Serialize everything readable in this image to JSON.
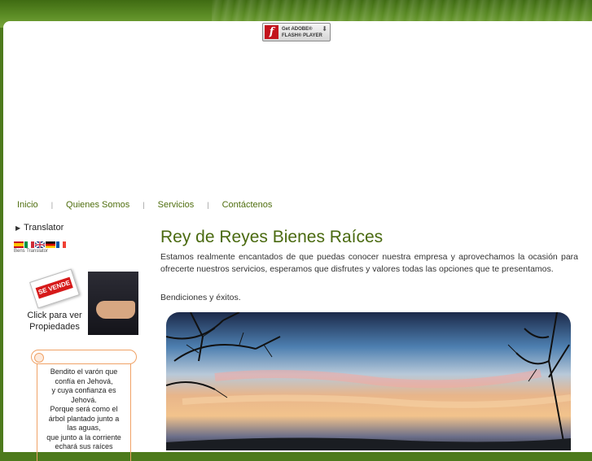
{
  "flash": {
    "text": "Get ADOBE®\nFLASH® PLAYER",
    "logo": "f"
  },
  "nav": {
    "items": [
      {
        "label": "Inicio"
      },
      {
        "label": "Quienes Somos"
      },
      {
        "label": "Servicios"
      },
      {
        "label": "Contáctenos"
      }
    ],
    "separator": "|"
  },
  "sidebar": {
    "translator_title": "Translator",
    "translator_caption": "Bens Translator",
    "flags": [
      "spanish-flag",
      "italian-flag",
      "uk-flag",
      "german-flag",
      "french-flag"
    ],
    "sale_ad": {
      "sign_text": "SE VENDE",
      "caption": "Click para ver Propiedades"
    },
    "verse": "Bendito el varón que\nconfía en Jehová,\ny cuya confianza es\nJehová.\nPorque será como el\nárbol plantado junto a\nlas aguas,\nque junto a la corriente\nechará sus raíces"
  },
  "main": {
    "title": "Rey de Reyes Bienes Raíces",
    "intro": "Estamos realmente encantados de que puedas conocer nuestra empresa y aprovechamos la ocasión para ofrecerte nuestros servicios, esperamos que disfrutes y valores todas las opciones que te presentamos.",
    "blessing": "Bendiciones y éxitos."
  },
  "colors": {
    "header_green": "#4d7a1c",
    "link_green": "#4f6e0e",
    "verse_border": "#f0a266"
  }
}
